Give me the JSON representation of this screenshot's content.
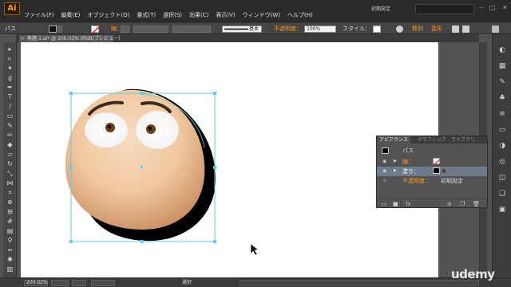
{
  "app": {
    "logo": "Ai",
    "workspace": "初期設定"
  },
  "menu": [
    "ファイル(F)",
    "編集(E)",
    "オブジェクト(O)",
    "書式(T)",
    "選択(S)",
    "効果(C)",
    "表示(V)",
    "ウィンドウ(W)",
    "ヘルプ(H)"
  ],
  "control": {
    "object_type": "パス",
    "stroke_label": "線：",
    "stroke_style": "基本",
    "opacity_label": "不透明度：",
    "opacity_value": "100%",
    "style_label": "スタイル：",
    "recolor_label": "数列",
    "transform_label": "変形"
  },
  "document_tab": {
    "title": "無題-1.ai* @ 200.02% (RGB/プレビュー)",
    "close_icon": "close-icon"
  },
  "panel": {
    "tabs": [
      "アピアランス",
      "グラフィック",
      "ライブラリ"
    ],
    "header_label": "パス",
    "rows": [
      {
        "label": "線：",
        "type": "stroke"
      },
      {
        "label": "塗り：",
        "type": "fill"
      },
      {
        "label": "不透明度：",
        "value": "初期設定"
      }
    ]
  },
  "status": {
    "zoom": "200.02%",
    "tool": "選択"
  },
  "watermark": "udemy",
  "colors": {
    "accent_orange": "#ff9a1a",
    "selection_blue": "#6d7a8c",
    "bounding_box": "#5ad1e6"
  }
}
